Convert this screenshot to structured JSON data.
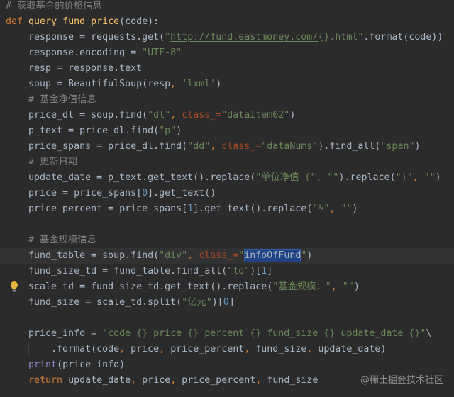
{
  "editor": {
    "language": "python",
    "lines": [
      {
        "tokens": [
          {
            "t": "# 获取基金的价格信息",
            "k": "comment"
          }
        ]
      },
      {
        "tokens": [
          {
            "t": "def",
            "k": "keyword"
          },
          {
            "t": " ",
            "k": "plain"
          },
          {
            "t": "query_fund_price",
            "k": "function"
          },
          {
            "t": "(code):",
            "k": "plain"
          }
        ]
      },
      {
        "tokens": [
          {
            "t": "    response = requests.get(",
            "k": "plain"
          },
          {
            "t": "\"",
            "k": "string"
          },
          {
            "t": "http://fund.eastmoney.com/",
            "k": "url"
          },
          {
            "t": "{}.html\"",
            "k": "string"
          },
          {
            "t": ".format(code))",
            "k": "plain"
          }
        ]
      },
      {
        "tokens": [
          {
            "t": "    response.encoding = ",
            "k": "plain"
          },
          {
            "t": "\"UTF-8\"",
            "k": "string"
          }
        ]
      },
      {
        "tokens": [
          {
            "t": "    resp = response.text",
            "k": "plain"
          }
        ]
      },
      {
        "tokens": [
          {
            "t": "    soup = BeautifulSoup(resp",
            "k": "plain"
          },
          {
            "t": ",",
            "k": "comma"
          },
          {
            "t": " ",
            "k": "plain"
          },
          {
            "t": "'lxml'",
            "k": "string"
          },
          {
            "t": ")",
            "k": "plain"
          }
        ]
      },
      {
        "tokens": [
          {
            "t": "    # 基金净值信息",
            "k": "comment"
          }
        ]
      },
      {
        "tokens": [
          {
            "t": "    price_dl = soup.find(",
            "k": "plain"
          },
          {
            "t": "\"dl\"",
            "k": "string"
          },
          {
            "t": ",",
            "k": "comma"
          },
          {
            "t": " ",
            "k": "plain"
          },
          {
            "t": "class_=",
            "k": "param"
          },
          {
            "t": "\"dataItem02\"",
            "k": "string"
          },
          {
            "t": ")",
            "k": "plain"
          }
        ]
      },
      {
        "tokens": [
          {
            "t": "    p_text = price_dl.find(",
            "k": "plain"
          },
          {
            "t": "\"p\"",
            "k": "string"
          },
          {
            "t": ")",
            "k": "plain"
          }
        ]
      },
      {
        "tokens": [
          {
            "t": "    price_spans = price_dl.find(",
            "k": "plain"
          },
          {
            "t": "\"dd\"",
            "k": "string"
          },
          {
            "t": ",",
            "k": "comma"
          },
          {
            "t": " ",
            "k": "plain"
          },
          {
            "t": "class_=",
            "k": "param"
          },
          {
            "t": "\"dataNums\"",
            "k": "string"
          },
          {
            "t": ").find_all(",
            "k": "plain"
          },
          {
            "t": "\"span\"",
            "k": "string"
          },
          {
            "t": ")",
            "k": "plain"
          }
        ]
      },
      {
        "tokens": [
          {
            "t": "    # 更新日期",
            "k": "comment"
          }
        ]
      },
      {
        "tokens": [
          {
            "t": "    update_date = p_text.get_text().replace(",
            "k": "plain"
          },
          {
            "t": "\"单位净值 (\"",
            "k": "string"
          },
          {
            "t": ",",
            "k": "comma"
          },
          {
            "t": " ",
            "k": "plain"
          },
          {
            "t": "\"\"",
            "k": "string"
          },
          {
            "t": ").replace(",
            "k": "plain"
          },
          {
            "t": "\")\"",
            "k": "string"
          },
          {
            "t": ",",
            "k": "comma"
          },
          {
            "t": " ",
            "k": "plain"
          },
          {
            "t": "\"\"",
            "k": "string"
          },
          {
            "t": ")",
            "k": "plain"
          }
        ]
      },
      {
        "tokens": [
          {
            "t": "    price = price_spans[",
            "k": "plain"
          },
          {
            "t": "0",
            "k": "number"
          },
          {
            "t": "].get_text()",
            "k": "plain"
          }
        ]
      },
      {
        "tokens": [
          {
            "t": "    price_percent = price_spans[",
            "k": "plain"
          },
          {
            "t": "1",
            "k": "number"
          },
          {
            "t": "].get_text().replace(",
            "k": "plain"
          },
          {
            "t": "\"%\"",
            "k": "string"
          },
          {
            "t": ",",
            "k": "comma"
          },
          {
            "t": " ",
            "k": "plain"
          },
          {
            "t": "\"\"",
            "k": "string"
          },
          {
            "t": ")",
            "k": "plain"
          }
        ]
      },
      {
        "tokens": []
      },
      {
        "tokens": [
          {
            "t": "    # 基金规模信息",
            "k": "comment"
          }
        ]
      },
      {
        "current": true,
        "gutter_icon": "lightbulb-icon",
        "tokens": [
          {
            "t": "    fund_table = soup.find(",
            "k": "plain"
          },
          {
            "t": "\"div\"",
            "k": "string"
          },
          {
            "t": ",",
            "k": "comma"
          },
          {
            "t": " ",
            "k": "plain"
          },
          {
            "t": "class_=",
            "k": "param"
          },
          {
            "t": "\"",
            "k": "string"
          },
          {
            "t": "infoOfFund",
            "k": "selected"
          },
          {
            "t": "\"",
            "k": "string"
          },
          {
            "t": ")",
            "k": "plain"
          }
        ]
      },
      {
        "tokens": [
          {
            "t": "    fund_size_td = fund_table.find_all(",
            "k": "plain"
          },
          {
            "t": "\"td\"",
            "k": "string"
          },
          {
            "t": ")[",
            "k": "plain"
          },
          {
            "t": "1",
            "k": "number"
          },
          {
            "t": "]",
            "k": "plain"
          }
        ]
      },
      {
        "tokens": [
          {
            "t": "    scale_td = fund_size_td.get_text().replace(",
            "k": "plain"
          },
          {
            "t": "\"基金规模：\"",
            "k": "string"
          },
          {
            "t": ",",
            "k": "comma"
          },
          {
            "t": " ",
            "k": "plain"
          },
          {
            "t": "\"\"",
            "k": "string"
          },
          {
            "t": ")",
            "k": "plain"
          }
        ]
      },
      {
        "tokens": [
          {
            "t": "    fund_size = scale_td.split(",
            "k": "plain"
          },
          {
            "t": "\"亿元\"",
            "k": "string"
          },
          {
            "t": ")[",
            "k": "plain"
          },
          {
            "t": "0",
            "k": "number"
          },
          {
            "t": "]",
            "k": "plain"
          }
        ]
      },
      {
        "tokens": []
      },
      {
        "tokens": [
          {
            "t": "    price_info = ",
            "k": "plain"
          },
          {
            "t": "\"code {} price {} percent {} fund_size {} update_date {}\"",
            "k": "string"
          },
          {
            "t": "\\",
            "k": "plain"
          }
        ]
      },
      {
        "tokens": [
          {
            "t": "        .format(code",
            "k": "plain"
          },
          {
            "t": ",",
            "k": "comma"
          },
          {
            "t": " price",
            "k": "plain"
          },
          {
            "t": ",",
            "k": "comma"
          },
          {
            "t": " price_percent",
            "k": "plain"
          },
          {
            "t": ",",
            "k": "comma"
          },
          {
            "t": " fund_size",
            "k": "plain"
          },
          {
            "t": ",",
            "k": "comma"
          },
          {
            "t": " update_date)",
            "k": "plain"
          }
        ]
      },
      {
        "tokens": [
          {
            "t": "    ",
            "k": "plain"
          },
          {
            "t": "print",
            "k": "builtin"
          },
          {
            "t": "(price_info)",
            "k": "plain"
          }
        ]
      },
      {
        "tokens": [
          {
            "t": "    ",
            "k": "plain"
          },
          {
            "t": "return",
            "k": "keyword"
          },
          {
            "t": " update_date",
            "k": "plain"
          },
          {
            "t": ",",
            "k": "comma"
          },
          {
            "t": " price",
            "k": "plain"
          },
          {
            "t": ",",
            "k": "comma"
          },
          {
            "t": " price_percent",
            "k": "plain"
          },
          {
            "t": ",",
            "k": "comma"
          },
          {
            "t": " fund_size",
            "k": "plain"
          }
        ]
      }
    ]
  },
  "watermark": "@稀土掘金技术社区",
  "colors": {
    "background": "#2b2b2b",
    "current_line": "#323232",
    "selection": "#214283",
    "plain": "#a9b7c6",
    "comment": "#808080",
    "keyword": "#cc7832",
    "function": "#ffc66d",
    "string": "#6a8759",
    "url": "#6a8759",
    "comma": "#cc7832",
    "param": "#aa4926",
    "number": "#6897bb",
    "builtin": "#8888c6",
    "selected": "#a9b7c6",
    "bulb": "#e8b53f"
  }
}
